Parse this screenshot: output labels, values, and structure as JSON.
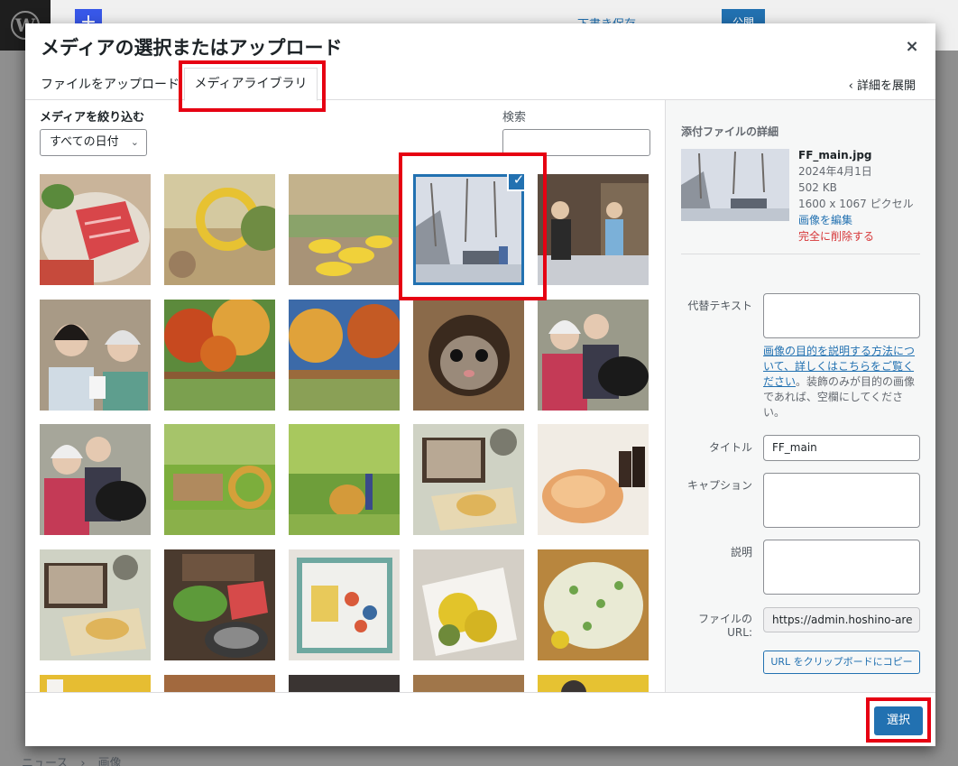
{
  "editor_bg": {
    "draft_label": "下書き保存",
    "publish_label": "公開",
    "breadcrumb": [
      "ニュース",
      "›",
      "画像"
    ]
  },
  "modal": {
    "title": "メディアの選択またはアップロード",
    "close_icon": "×",
    "tabs": {
      "upload": "ファイルをアップロード",
      "library": "メディアライブラリ"
    },
    "expand_details": "‹  詳細を展開"
  },
  "filter": {
    "label": "メディアを絞り込む",
    "date_value": "すべての日付",
    "search_label": "検索",
    "search_value": ""
  },
  "thumbnails": [
    {
      "subject": "wagyu-shabu",
      "selected": false
    },
    {
      "subject": "flower-wreath",
      "selected": false
    },
    {
      "subject": "yellow-tables-picnic",
      "selected": false
    },
    {
      "subject": "snowy-street",
      "selected": true
    },
    {
      "subject": "snow-sweeping",
      "selected": false
    },
    {
      "subject": "women-kakigori",
      "selected": false
    },
    {
      "subject": "autumn-maples",
      "selected": false
    },
    {
      "subject": "autumn-park",
      "selected": false
    },
    {
      "subject": "flying-squirrel",
      "selected": false
    },
    {
      "subject": "couple-with-dog",
      "selected": false
    },
    {
      "subject": "couple-with-dog-2",
      "selected": false
    },
    {
      "subject": "spring-playground",
      "selected": false
    },
    {
      "subject": "spring-park-people",
      "selected": false
    },
    {
      "subject": "soba-tempura",
      "selected": false
    },
    {
      "subject": "bonito-flakes",
      "selected": false
    },
    {
      "subject": "soba-tempura-2",
      "selected": false
    },
    {
      "subject": "hotpot-set",
      "selected": false
    },
    {
      "subject": "flower-furoshiki",
      "selected": false
    },
    {
      "subject": "mimosa-box",
      "selected": false
    },
    {
      "subject": "floral-shirt",
      "selected": false
    }
  ],
  "details": {
    "heading": "添付ファイルの詳細",
    "filename": "FF_main.jpg",
    "date": "2024年4月1日",
    "size": "502 KB",
    "dimensions": "1600 x 1067 ピクセル",
    "edit_link": "画像を編集",
    "delete_link": "完全に削除する",
    "alt_label": "代替テキスト",
    "alt_value": "",
    "help_link": "画像の目的を説明する方法について、詳しくはこちらをご覧ください",
    "help_text": "。装飾のみが目的の画像であれば、空欄にしてください。",
    "title_label": "タイトル",
    "title_value": "FF_main",
    "caption_label": "キャプション",
    "caption_value": "",
    "desc_label": "説明",
    "desc_value": "",
    "url_label": "ファイルの URL:",
    "url_value": "https://admin.hoshino-are",
    "copy_button": "URL をクリップボードにコピー"
  },
  "footer": {
    "select_button": "選択"
  },
  "colors": {
    "accent": "#2271b1",
    "danger": "#d63638",
    "annotation_red": "#e60012"
  }
}
